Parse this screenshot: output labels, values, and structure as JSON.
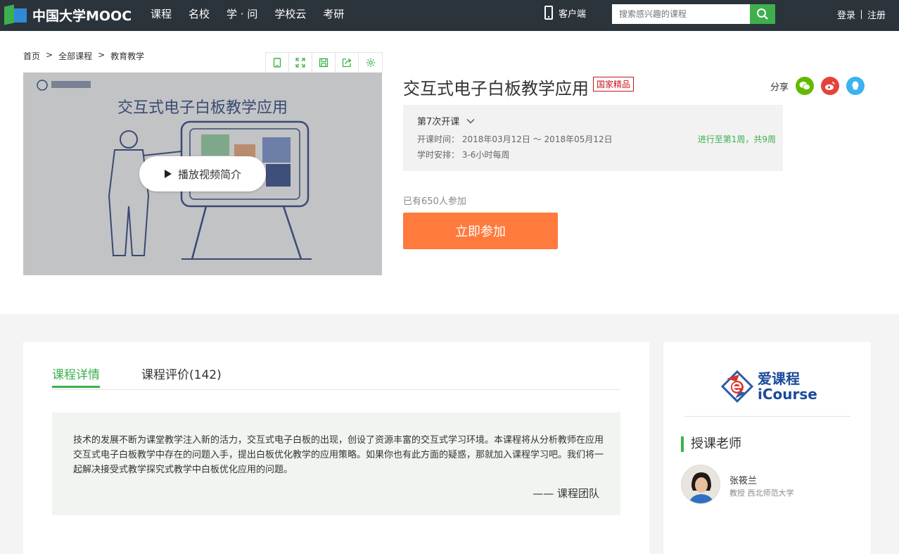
{
  "topbar": {
    "brand": "中国大学MOOC",
    "nav": [
      "课程",
      "名校",
      "学 · 问",
      "学校云",
      "考研"
    ],
    "client_label": "客户端",
    "search_placeholder": "搜索感兴趣的课程",
    "login": "登录",
    "register": "注册",
    "colors": {
      "bg": "#2b333b",
      "accent": "#3db04d"
    }
  },
  "breadcrumb": [
    "首页",
    ">",
    "全部课程",
    ">",
    "教育教学"
  ],
  "video": {
    "play_label": "播放视频简介",
    "slide_title": "交互式电子白板教学应用"
  },
  "course": {
    "title": "交互式电子白板教学应用",
    "badge": "国家精品",
    "share_label": "分享",
    "term": "第7次开课",
    "time_label": "开课时间：",
    "time_value": "2018年03月12日 ～ 2018年05月12日",
    "schedule_label": "学时安排：",
    "schedule_value": "3-6小时每周",
    "progress": "进行至第1周，共9周",
    "enrolled": "已有650人参加",
    "join_button": "立即参加",
    "join_color": "#ff7a3d"
  },
  "tabs": {
    "detail": "课程详情",
    "reviews": "课程评价(142)"
  },
  "description": {
    "text": "技术的发展不断为课堂教学注入新的活力，交互式电子白板的出现，创设了资源丰富的交互式学习环境。本课程将从分析教师在应用交互式电子白板教学中存在的问题入手，提出白板优化教学的应用策略。如果你也有此方面的疑惑，那就加入课程学习吧。我们将一起解决接受式教学探究式教学中白板优化应用的问题。",
    "signature": "—— 课程团队"
  },
  "sidebar": {
    "logo_cn": "爱课程",
    "logo_en": "iCourse",
    "teacher_heading": "授课老师",
    "teacher_name": "张筱兰",
    "teacher_title": "教授 西北师范大学"
  }
}
